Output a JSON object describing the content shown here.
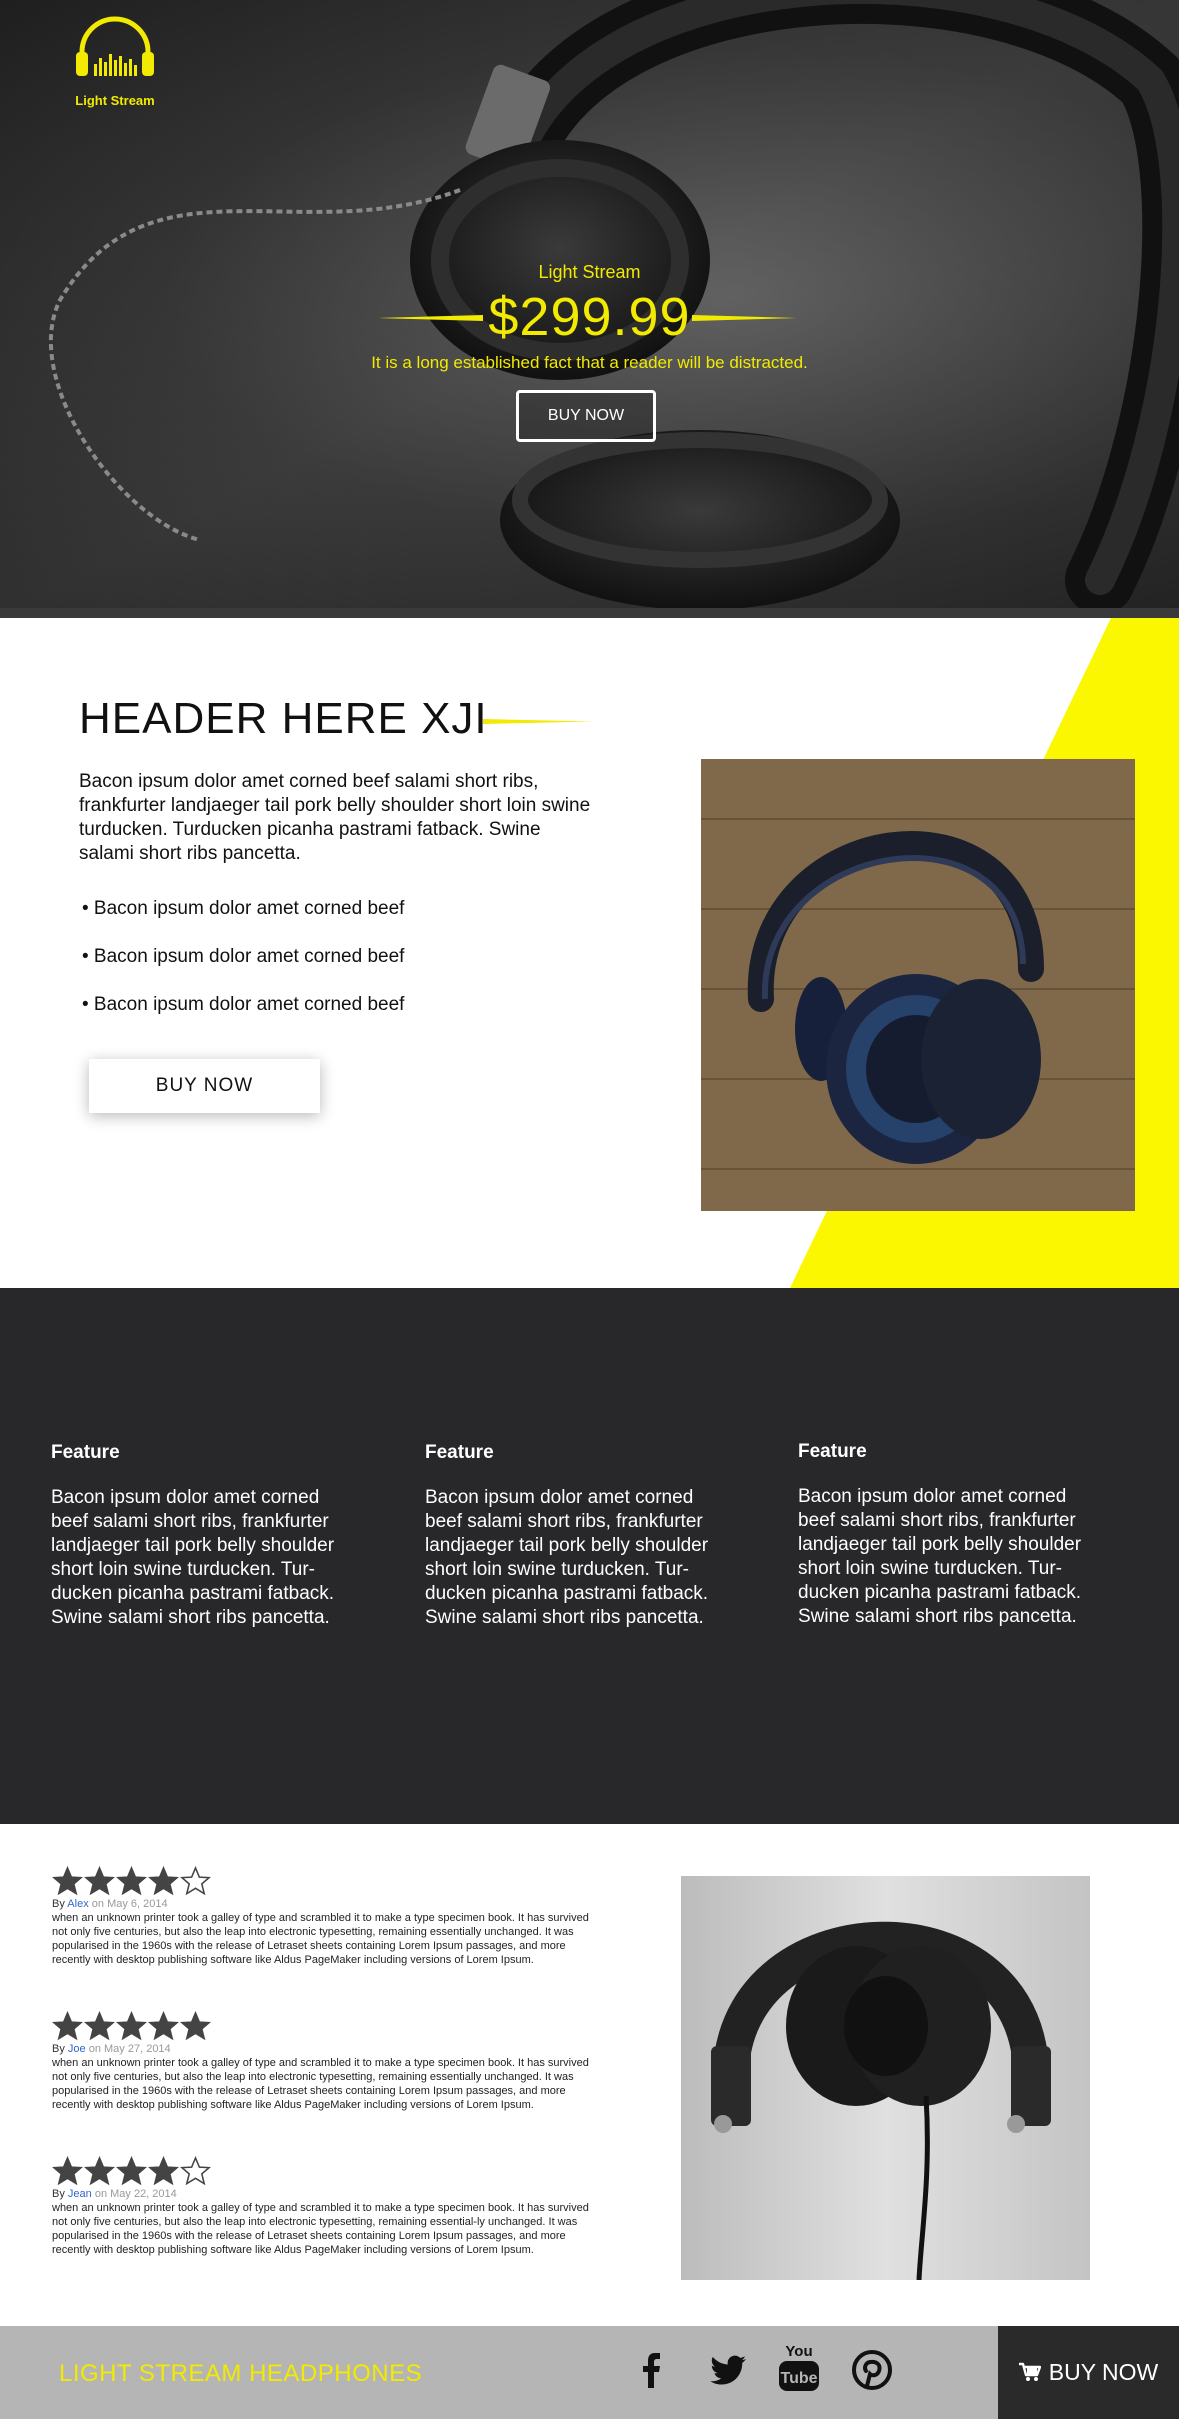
{
  "hero": {
    "logo_text": "Light Stream",
    "brand": "Light Stream",
    "price": "$299.99",
    "tagline": "It is a long established fact that a reader will be distracted.",
    "buy_label": "BUY NOW"
  },
  "intro": {
    "title": "HEADER HERE XJI",
    "paragraph": "Bacon ipsum dolor amet corned beef salami short ribs, frankfurter landjaeger tail pork belly shoulder short loin swine turducken. Turducken picanha pastrami fatback. Swine salami short ribs pancetta.",
    "bullets": [
      "• Bacon ipsum dolor amet corned beef",
      "• Bacon ipsum dolor amet corned beef",
      "• Bacon ipsum dolor amet corned beef"
    ],
    "buy_label": "BUY NOW"
  },
  "features": [
    {
      "title": "Feature",
      "body": "Bacon ipsum dolor amet corned beef salami short ribs, frankfurter landjaeger tail pork belly shoulder short loin swine turducken. Tur-ducken picanha pastrami fatback. Swine salami short ribs pancetta."
    },
    {
      "title": "Feature",
      "body": "Bacon ipsum dolor amet corned beef salami short ribs, frankfurter landjaeger tail pork belly shoulder short loin swine turducken. Tur-ducken picanha pastrami fatback. Swine salami short ribs pancetta."
    },
    {
      "title": "Feature",
      "body": "Bacon ipsum dolor amet corned beef salami short ribs, frankfurter landjaeger tail pork belly shoulder short loin swine turducken. Tur-ducken picanha pastrami fatback. Swine salami short ribs pancetta."
    }
  ],
  "reviews": [
    {
      "rating": 4,
      "by": "By ",
      "author": "Alex",
      "on": " on ",
      "date": "May 6, 2014",
      "body": "when an unknown printer took a galley of type and scrambled it to make a type specimen book. It has survived not only five centuries, but also the leap into electronic typesetting, remaining essentially unchanged. It was popularised in the 1960s with the release of Letraset sheets containing Lorem Ipsum passages, and more recently with desktop publishing software like Aldus PageMaker including versions of Lorem Ipsum."
    },
    {
      "rating": 5,
      "by": "By ",
      "author": "Joe",
      "on": " on ",
      "date": "May 27, 2014",
      "body": "when an unknown printer took a galley of type and scrambled it to make a type specimen book. It has survived not only five centuries, but also the leap into electronic typesetting, remaining essentially unchanged. It was popularised in the 1960s with the release of Letraset sheets containing Lorem Ipsum passages, and more recently with desktop publishing software like Aldus PageMaker including versions of Lorem Ipsum."
    },
    {
      "rating": 4,
      "by": "By ",
      "author": "Jean",
      "on": " on ",
      "date": "May 22, 2014",
      "body": "when an unknown printer took a galley of type and scrambled it to make a type specimen book. It has survived not only five centuries, but also the leap into electronic typesetting, remaining essential-ly unchanged. It was popularised in the 1960s with the release of Letraset sheets containing Lorem Ipsum passages, and more recently with desktop publishing software like Aldus PageMaker including versions of Lorem Ipsum."
    }
  ],
  "footer": {
    "brand": "LIGHT STREAM HEADPHONES",
    "social": [
      "facebook-icon",
      "twitter-icon",
      "youtube-icon",
      "pinterest-icon"
    ],
    "youtube_text_top": "You",
    "youtube_text_bottom": "Tube",
    "buy_label": "BUY NOW"
  },
  "colors": {
    "accent": "#f2ea00",
    "dark": "#28282a",
    "footer_bg": "#b5b5b5",
    "link": "#3366cc"
  }
}
